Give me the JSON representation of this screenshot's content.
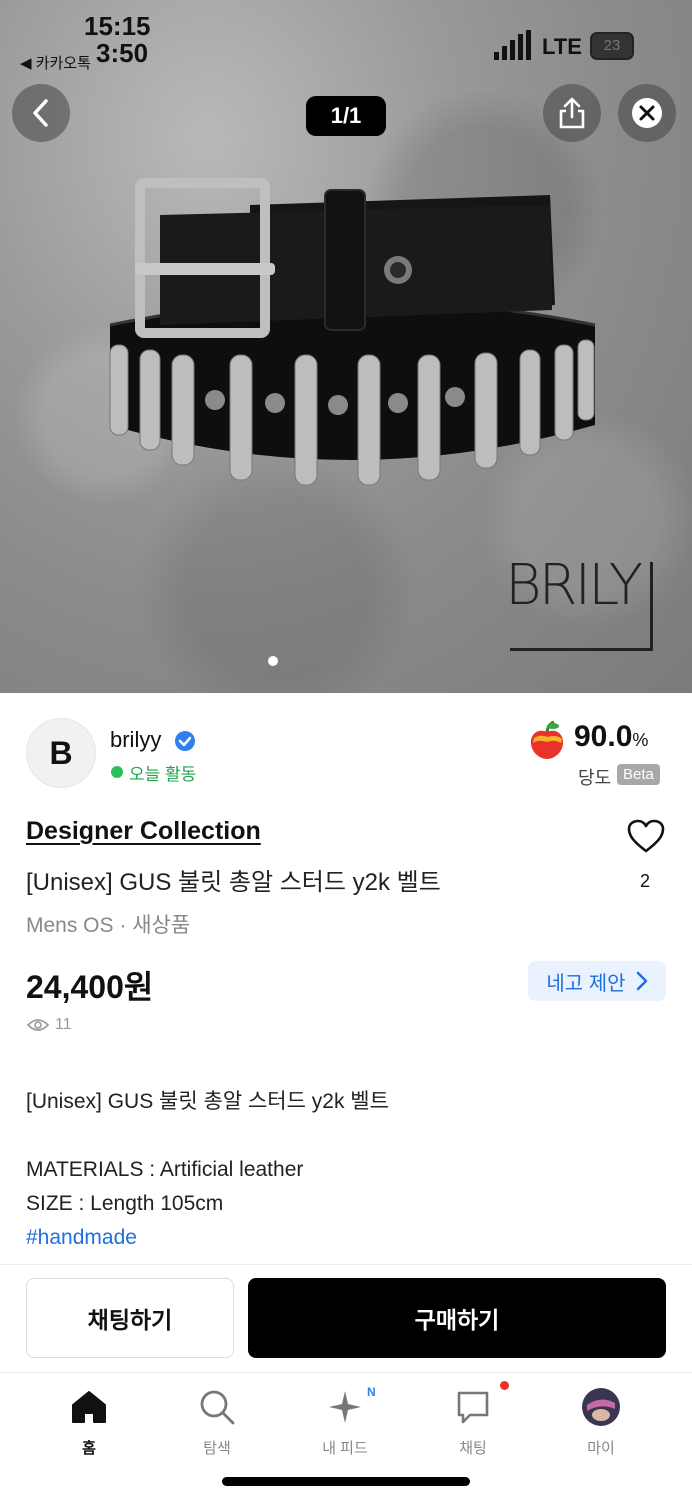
{
  "status_bar": {
    "time_top": "15:15",
    "time_bottom": "3:50",
    "back_app": "◀ 카카오톡",
    "network": "LTE",
    "battery": "23"
  },
  "image_viewer": {
    "counter": "1/1",
    "watermark": "BRILY"
  },
  "seller": {
    "avatar_letter": "B",
    "name": "brilyy",
    "activity": "오늘 활동",
    "score": "90.0",
    "score_unit": "%",
    "score_label": "당도",
    "beta_label": "Beta"
  },
  "product": {
    "collection": "Designer Collection",
    "title": "[Unisex] GUS 불릿 총알 스터드 y2k 벨트",
    "meta": "Mens OS · 새상품",
    "likes": "2",
    "price": "24,400원",
    "offer_label": "네고 제안",
    "views": "11"
  },
  "description": {
    "line1": "[Unisex] GUS 불릿 총알 스터드 y2k 벨트",
    "line2": "MATERIALS : Artificial leather",
    "line3": "SIZE : Length 105cm",
    "tag": "#handmade"
  },
  "actions": {
    "chat": "채팅하기",
    "buy": "구매하기"
  },
  "tabbar": {
    "home": "홈",
    "search": "탐색",
    "feed": "내 피드",
    "feed_badge": "N",
    "chat": "채팅",
    "my": "마이"
  },
  "colors": {
    "accent_blue": "#1e6fe0",
    "active_green": "#2dbd59",
    "buy_button": "#000000"
  }
}
